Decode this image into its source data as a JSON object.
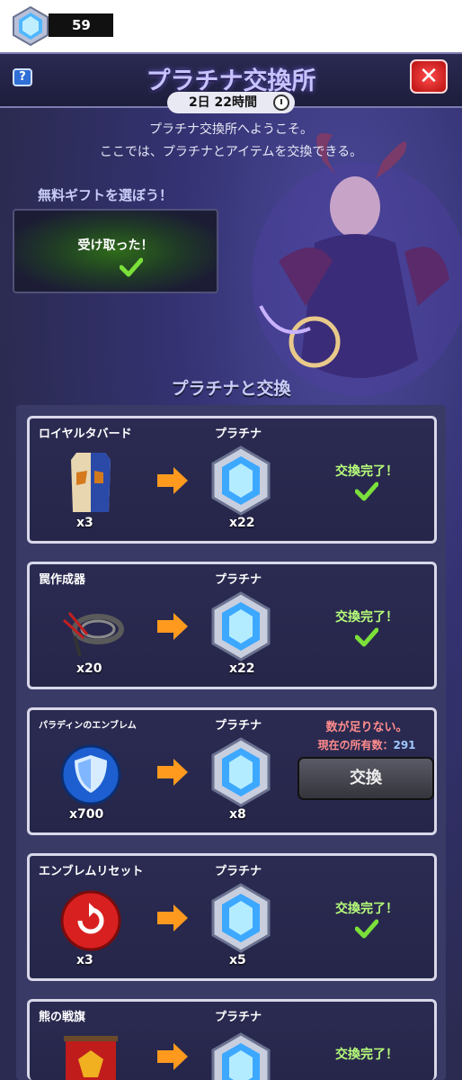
{
  "currency": {
    "icon": "platinum-gem-icon",
    "amount": "59"
  },
  "header": {
    "title": "プラチナ交換所",
    "help_label": "?",
    "close_label": "✕",
    "timer": "2日 22時間"
  },
  "intro": {
    "line1": "プラチナ交換所へようこそ。",
    "line2": "ここでは、プラチナとアイテムを交換できる。"
  },
  "free_gift": {
    "label": "無料ギフトを選ぼう！",
    "status": "受け取った！"
  },
  "section_title": "プラチナと交換",
  "rows": [
    {
      "name": "ロイヤルタバード",
      "icon": "tabard-icon",
      "in_qty": "x3",
      "out_name": "プラチナ",
      "out_qty": "x22",
      "status": "交換完了！"
    },
    {
      "name": "罠作成器",
      "icon": "trap-maker-icon",
      "in_qty": "x20",
      "out_name": "プラチナ",
      "out_qty": "x22",
      "status": "交換完了！"
    },
    {
      "name": "パラディンのエンブレム",
      "icon": "paladin-emblem-icon",
      "in_qty": "x700",
      "out_name": "プラチナ",
      "out_qty": "x8",
      "short": "数が足りない。",
      "owned_label": "現在の所有数：",
      "owned_value": "291",
      "button": "交換"
    },
    {
      "name": "エンブレムリセット",
      "icon": "emblem-reset-icon",
      "in_qty": "x3",
      "out_name": "プラチナ",
      "out_qty": "x5",
      "status": "交換完了！"
    },
    {
      "name": "熊の戦旗",
      "icon": "bear-banner-icon",
      "in_qty": "",
      "out_name": "プラチナ",
      "out_qty": "",
      "status": "交換完了！"
    }
  ],
  "colors": {
    "accent": "#c9cdf7",
    "done": "#b8ff7a",
    "warning": "#ff8c8c",
    "close": "#d41818"
  }
}
